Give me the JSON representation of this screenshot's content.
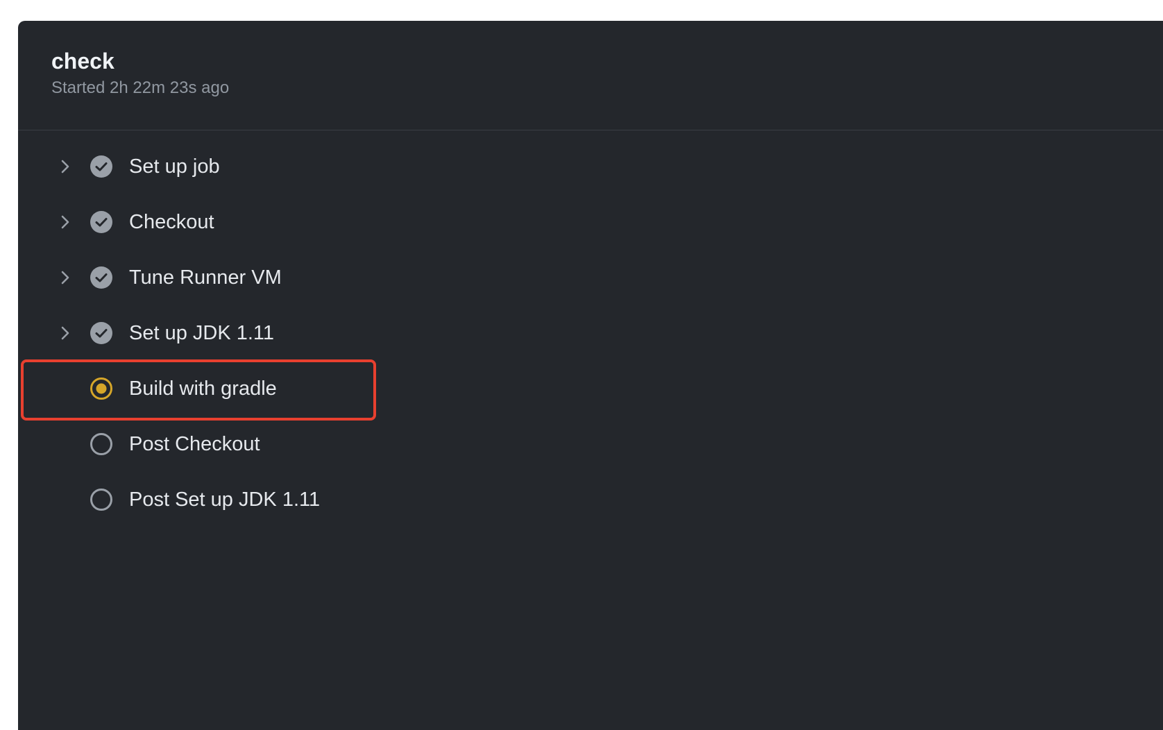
{
  "job": {
    "title": "check",
    "subtitle": "Started 2h 22m 23s ago"
  },
  "steps": [
    {
      "label": "Set up job",
      "status": "success",
      "expandable": true
    },
    {
      "label": "Checkout",
      "status": "success",
      "expandable": true
    },
    {
      "label": "Tune Runner VM",
      "status": "success",
      "expandable": true
    },
    {
      "label": "Set up JDK 1.11",
      "status": "success",
      "expandable": true
    },
    {
      "label": "Build with gradle",
      "status": "in-progress",
      "expandable": false,
      "highlighted": true
    },
    {
      "label": "Post Checkout",
      "status": "queued",
      "expandable": false
    },
    {
      "label": "Post Set up JDK 1.11",
      "status": "queued",
      "expandable": false
    }
  ],
  "icons": {
    "expand": "chevron-right-icon",
    "success": "check-circle-icon",
    "in-progress": "in-progress-dot-icon",
    "queued": "empty-circle-icon"
  },
  "colors": {
    "panel_bg": "#24272c",
    "success_icon": "#9aa0a8",
    "in_progress": "#d6a629",
    "queued_ring": "#9aa0a8",
    "highlight": "#e8402f"
  }
}
